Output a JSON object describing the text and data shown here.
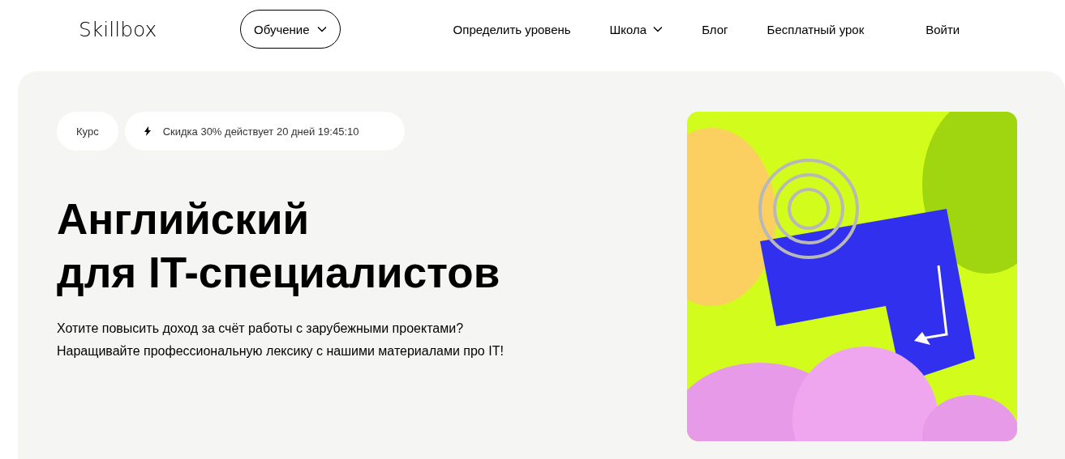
{
  "header": {
    "logo": "Skillbox",
    "catalog_button": {
      "label": "Обучение"
    },
    "nav": [
      {
        "label": "Определить уровень",
        "has_menu": false
      },
      {
        "label": "Школа",
        "has_menu": true
      },
      {
        "label": "Блог",
        "has_menu": false
      },
      {
        "label": "Бесплатный урок",
        "has_menu": false
      }
    ],
    "login": "Войти"
  },
  "hero": {
    "tag": "Курс",
    "discount": "Скидка 30% действует 20 дней 19:45:10",
    "title_lines": [
      "Английский",
      "для IT-специалистов"
    ],
    "description_lines": [
      "Хотите повысить доход за счёт работы с зарубежными проектами?",
      "Наращивайте профессиональную лексику с нашими материалами про IT!"
    ]
  }
}
